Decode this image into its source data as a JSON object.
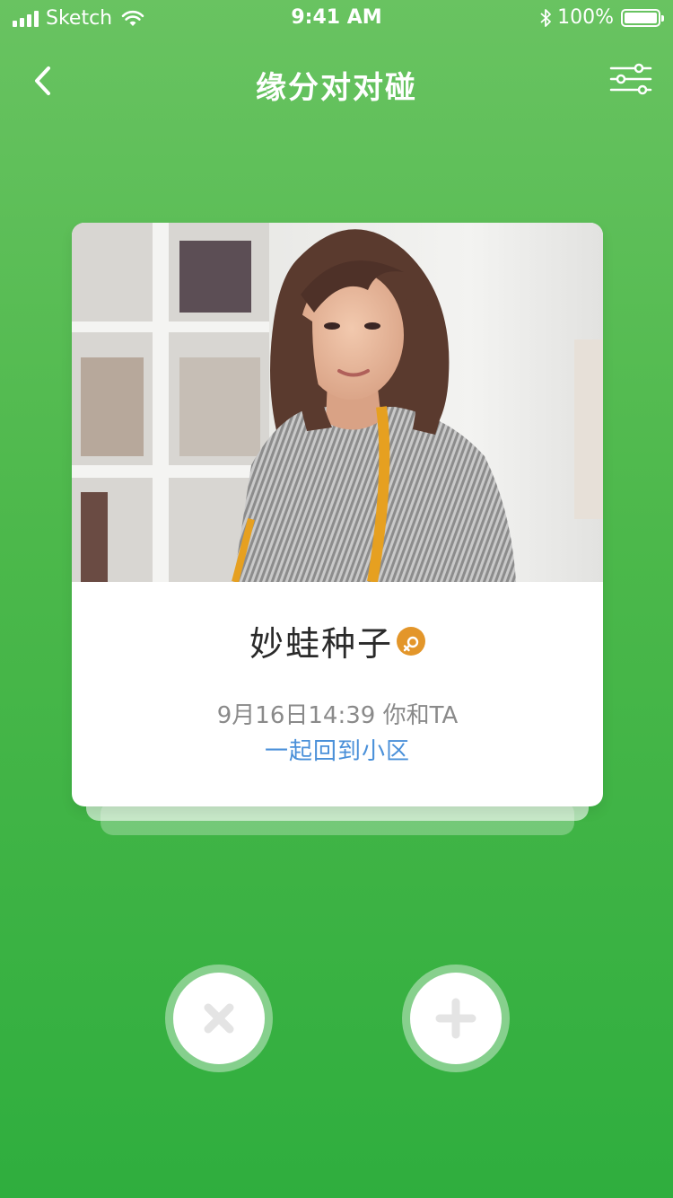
{
  "status_bar": {
    "carrier": "Sketch",
    "time": "9:41 AM",
    "battery": "100%",
    "battery_level": 1.0,
    "signal_bars": 4
  },
  "nav": {
    "title": "缘分对对碰",
    "back_icon": "chevron-left-icon",
    "filter_icon": "sliders-icon"
  },
  "card": {
    "photo_icon": "profile-photo",
    "name": "妙蛙种子",
    "gender_icon": "female-icon",
    "gender_color": "#e3962a",
    "meta": "9月16日14:39 你和TA",
    "link": "一起回到小区",
    "link_color": "#4a90d9"
  },
  "actions": {
    "dislike_icon": "close-icon",
    "like_icon": "plus-icon"
  },
  "colors": {
    "background_top": "#69c361",
    "background_bottom": "#2fae3e"
  }
}
